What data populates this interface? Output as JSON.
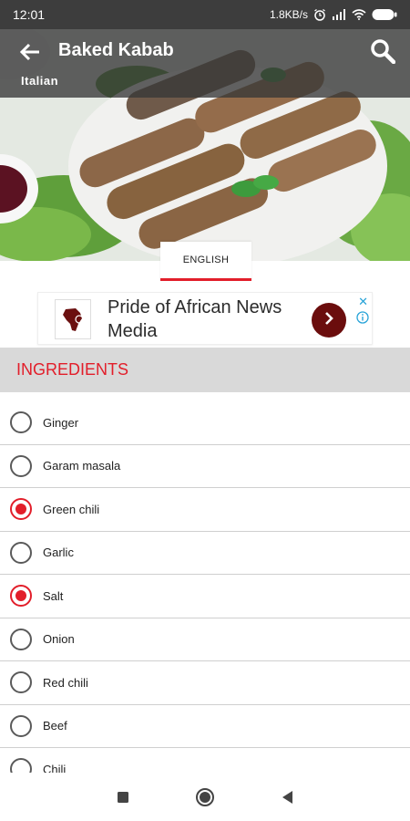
{
  "status_bar": {
    "time": "12:01",
    "network_speed": "1.8KB/s",
    "battery": "38",
    "icons": [
      "alarm-icon",
      "signal-icon",
      "wifi-icon",
      "battery-icon"
    ]
  },
  "app_bar": {
    "title": "Baked Kabab",
    "subtitle": "Italian",
    "back_icon": "arrow-left-icon",
    "search_icon": "search-icon"
  },
  "language_tab": {
    "label": "ENGLISH"
  },
  "ad": {
    "text": "Pride of African News Media",
    "close_glyph": "✕",
    "icons": [
      "africa-logo-icon",
      "chevron-right-icon",
      "info-icon"
    ]
  },
  "ingredients": {
    "header": "INGREDIENTS",
    "items": [
      {
        "label": "Ginger",
        "checked": false
      },
      {
        "label": "Garam masala",
        "checked": false
      },
      {
        "label": "Green chili",
        "checked": true
      },
      {
        "label": "Garlic",
        "checked": false
      },
      {
        "label": "Salt",
        "checked": true
      },
      {
        "label": "Onion",
        "checked": false
      },
      {
        "label": "Red chili",
        "checked": false
      },
      {
        "label": "Beef",
        "checked": false
      },
      {
        "label": "Chili",
        "checked": false
      }
    ]
  },
  "nav_bar": {
    "icons": [
      "recents-square-icon",
      "home-circle-icon",
      "back-triangle-icon"
    ]
  },
  "colors": {
    "accent": "#e21e2a",
    "status_bar": "#3d3d3d",
    "section_header_bg": "#d9d9d9",
    "ad_button": "#6b0d0d"
  }
}
